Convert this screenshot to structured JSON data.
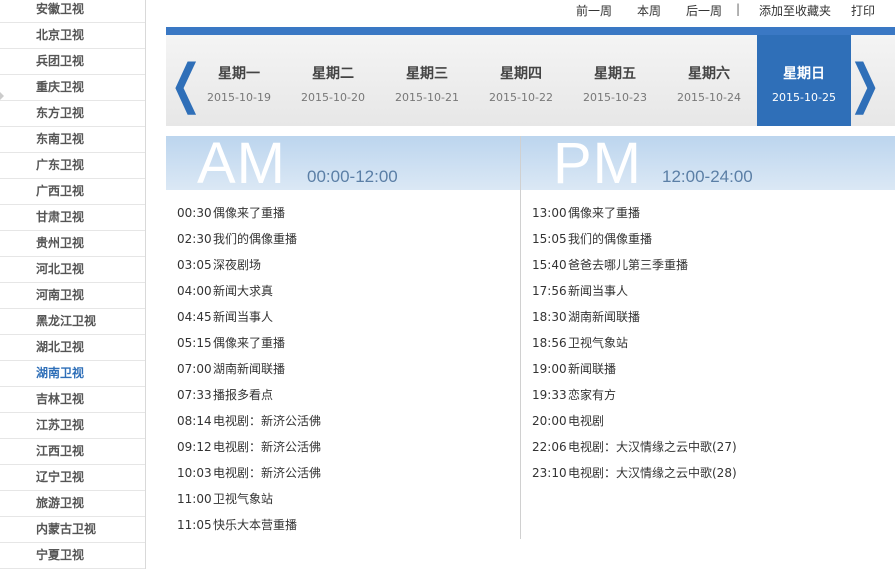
{
  "sidebar": {
    "channels": [
      "安徽卫视",
      "北京卫视",
      "兵团卫视",
      "重庆卫视",
      "东方卫视",
      "东南卫视",
      "广东卫视",
      "广西卫视",
      "甘肃卫视",
      "贵州卫视",
      "河北卫视",
      "河南卫视",
      "黑龙江卫视",
      "湖北卫视",
      "湖南卫视",
      "吉林卫视",
      "江苏卫视",
      "江西卫视",
      "辽宁卫视",
      "旅游卫视",
      "内蒙古卫视",
      "宁夏卫视"
    ],
    "active": "湖南卫视"
  },
  "toplinks": {
    "prev_week": "前一周",
    "this_week": "本周",
    "next_week": "后一周",
    "separator": "|",
    "favorite": "添加至收藏夹",
    "print": "打印"
  },
  "week": {
    "days": [
      {
        "name": "星期一",
        "date": "2015-10-19"
      },
      {
        "name": "星期二",
        "date": "2015-10-20"
      },
      {
        "name": "星期三",
        "date": "2015-10-21"
      },
      {
        "name": "星期四",
        "date": "2015-10-22"
      },
      {
        "name": "星期五",
        "date": "2015-10-23"
      },
      {
        "name": "星期六",
        "date": "2015-10-24"
      },
      {
        "name": "星期日",
        "date": "2015-10-25"
      }
    ],
    "active_index": 6,
    "prev_glyph": "❮",
    "next_glyph": "❯"
  },
  "am": {
    "label": "AM",
    "range": "00:00-12:00",
    "programs": [
      {
        "time": "00:30",
        "title": "偶像来了重播"
      },
      {
        "time": "02:30",
        "title": "我们的偶像重播"
      },
      {
        "time": "03:05",
        "title": "深夜剧场"
      },
      {
        "time": "04:00",
        "title": "新闻大求真"
      },
      {
        "time": "04:45",
        "title": "新闻当事人"
      },
      {
        "time": "05:15",
        "title": "偶像来了重播"
      },
      {
        "time": "07:00",
        "title": "湖南新闻联播"
      },
      {
        "time": "07:33",
        "title": "播报多看点"
      },
      {
        "time": "08:14",
        "title": "电视剧：新济公活佛"
      },
      {
        "time": "09:12",
        "title": "电视剧：新济公活佛"
      },
      {
        "time": "10:03",
        "title": "电视剧：新济公活佛"
      },
      {
        "time": "11:00",
        "title": "卫视气象站"
      },
      {
        "time": "11:05",
        "title": "快乐大本营重播"
      }
    ]
  },
  "pm": {
    "label": "PM",
    "range": "12:00-24:00",
    "programs": [
      {
        "time": "13:00",
        "title": "偶像来了重播"
      },
      {
        "time": "15:05",
        "title": "我们的偶像重播"
      },
      {
        "time": "15:40",
        "title": "爸爸去哪儿第三季重播"
      },
      {
        "time": "17:56",
        "title": "新闻当事人"
      },
      {
        "time": "18:30",
        "title": "湖南新闻联播"
      },
      {
        "time": "18:56",
        "title": "卫视气象站"
      },
      {
        "time": "19:00",
        "title": "新闻联播"
      },
      {
        "time": "19:33",
        "title": "恋家有方"
      },
      {
        "time": "20:00",
        "title": "电视剧"
      },
      {
        "time": "22:06",
        "title": "电视剧：大汉情缘之云中歌(27)"
      },
      {
        "time": "23:10",
        "title": "电视剧：大汉情缘之云中歌(28)"
      }
    ]
  },
  "colors": {
    "accent": "#2f6fb8",
    "active_channel": "#2f6fb8",
    "header_band": "#bcd5ee"
  }
}
